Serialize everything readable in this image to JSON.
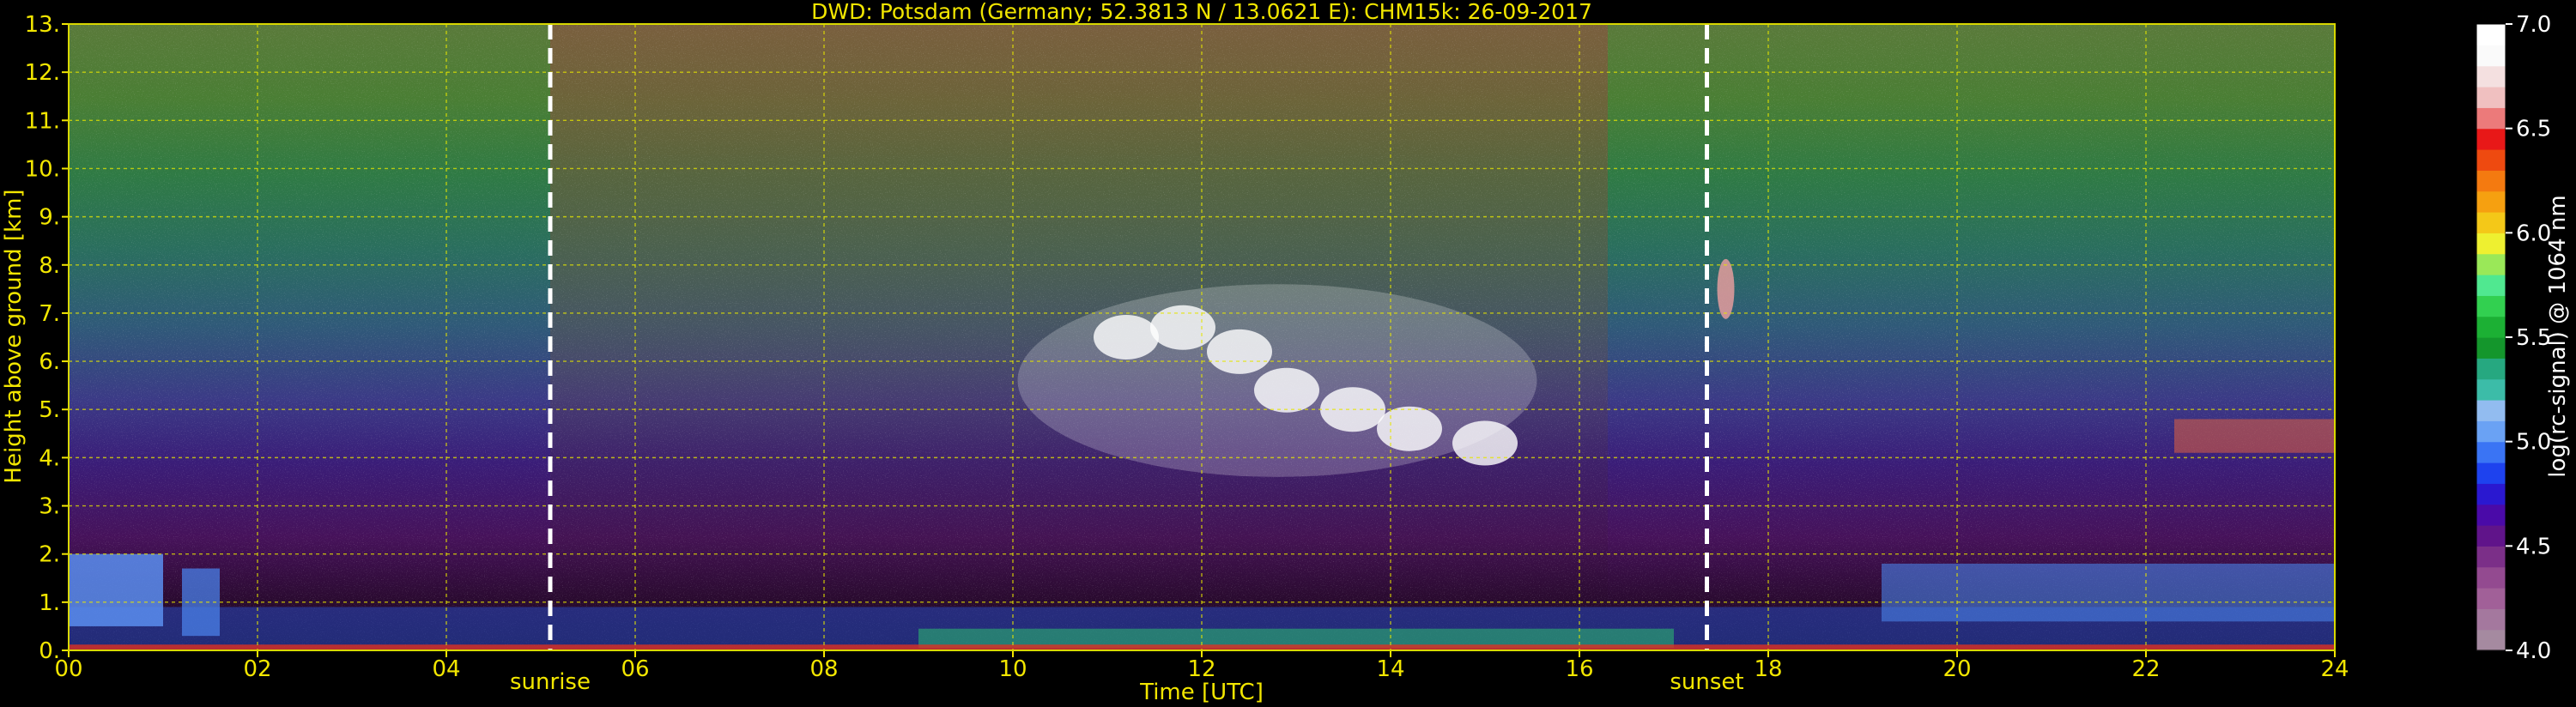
{
  "chart_data": {
    "type": "heatmap",
    "title": "DWD: Potsdam (Germany; 52.3813 N / 13.0621 E):    CHM15k: 26-09-2017",
    "xlabel": "Time [UTC]",
    "ylabel": "Height above ground [km]",
    "xlim": [
      0,
      24
    ],
    "ylim": [
      0,
      13
    ],
    "x_ticks": [
      "00",
      "02",
      "04",
      "06",
      "08",
      "10",
      "12",
      "14",
      "16",
      "18",
      "20",
      "22",
      "24"
    ],
    "y_ticks": [
      "0.",
      "1.",
      "2.",
      "3.",
      "4.",
      "5.",
      "6.",
      "7.",
      "8.",
      "9.",
      "10.",
      "11.",
      "12.",
      "13."
    ],
    "grid": true,
    "markers": [
      {
        "label": "sunrise",
        "time_utc": 5.1
      },
      {
        "label": "sunset",
        "time_utc": 17.35
      }
    ],
    "colorbar": {
      "label": "log(rc-signal) @ 1064 nm",
      "range": [
        4.0,
        7.0
      ],
      "ticks": [
        "4.0",
        "4.5",
        "5.0",
        "5.5",
        "6.0",
        "6.5",
        "7.0"
      ],
      "colors": [
        "#a58aa0",
        "#a4789e",
        "#a16098",
        "#934a90",
        "#7b2f88",
        "#60148a",
        "#4a0aa8",
        "#2a18d0",
        "#1e42ee",
        "#3a74f4",
        "#6aa2f4",
        "#92bcf0",
        "#3cbca8",
        "#26a880",
        "#14962c",
        "#1cb034",
        "#32d050",
        "#50e890",
        "#9ae858",
        "#eef030",
        "#f4c818",
        "#f6a010",
        "#f47a10",
        "#ee4a10",
        "#e81818",
        "#ec7a7a",
        "#f0c0c0",
        "#f4e0e0",
        "#fafafa",
        "#ffffff"
      ]
    },
    "features": [
      {
        "name": "boundary layer",
        "x": [
          0,
          24
        ],
        "height_km": [
          0,
          0.9
        ]
      },
      {
        "name": "residual layer aerosol",
        "x": [
          0,
          1
        ],
        "height_km": [
          0.5,
          2.0
        ]
      },
      {
        "name": "cirrus cloud",
        "x": [
          9.8,
          15.3
        ],
        "height_km": [
          3.8,
          7.8
        ]
      },
      {
        "name": "cloud fragments",
        "x": [
          17.4,
          17.7
        ],
        "height_km": [
          6.5,
          8.3
        ]
      },
      {
        "name": "aerosol layer",
        "x": [
          19.2,
          24
        ],
        "height_km": [
          0.6,
          1.8
        ]
      }
    ]
  }
}
